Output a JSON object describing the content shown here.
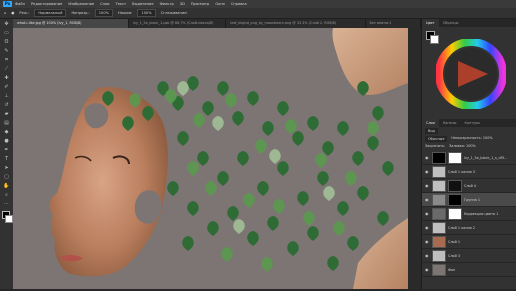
{
  "app": {
    "logo": "Ps"
  },
  "menu": [
    "Файл",
    "Редактирование",
    "Изображение",
    "Слои",
    "Текст",
    "Выделение",
    "Фильтр",
    "3D",
    "Просмотр",
    "Окно",
    "Справка"
  ],
  "options": {
    "mode_label": "Реж.:",
    "mode_value": "Нормальный",
    "opacity_label": "Непрозр.:",
    "opacity_value": "100%",
    "flow_label": "Нажим:",
    "flow_value": "100%",
    "smoothing_label": "Сглаживание:"
  },
  "tabs": [
    "what-i-like.jpg @ 100% (Ivy_1, RGB/8)",
    "ivy_1_5a_black_1.psb @ 66,7% (Слой-маска/8)",
    "leaf_bkgnd_png_by_moonbeam.png @ 33,3% (Слой 2, RGB/8)",
    "Без имени-1"
  ],
  "panels": {
    "color_tabs": [
      "Цвет",
      "Образцы"
    ],
    "color_accent": "#e6543b",
    "layers_tabs": [
      "Слои",
      "Каналы",
      "Контуры"
    ],
    "kind_label": "Вид",
    "blend_label": "Обычные",
    "opacity_label": "Непрозрачность: 100%",
    "lock_label": "Закрепить:",
    "fill_label": "Заливка: 100%",
    "layers": [
      {
        "name": "ivy_1_5a_black_1_s_d5f..."
      },
      {
        "name": "Слой 1 копия 3"
      },
      {
        "name": "Слой 4"
      },
      {
        "name": "Группа 1"
      },
      {
        "name": "Коррекция цвета 1"
      },
      {
        "name": "Слой 1 копия 2"
      },
      {
        "name": "Слой 1"
      },
      {
        "name": "Слой 3"
      },
      {
        "name": "Фон"
      }
    ]
  }
}
